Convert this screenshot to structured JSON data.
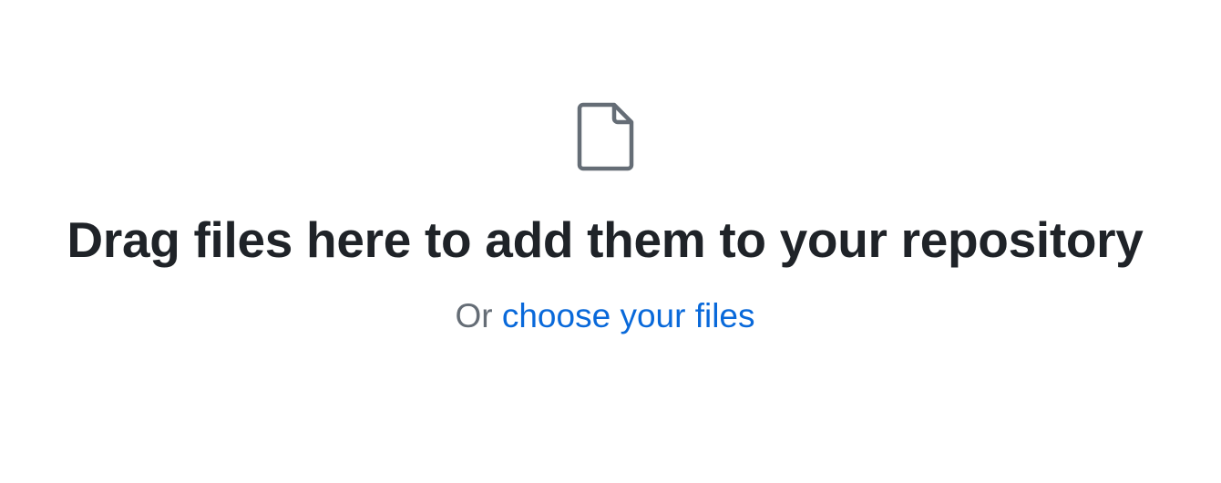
{
  "dropzone": {
    "icon": "file-icon",
    "heading": "Drag files here to add them to your repository",
    "prefix": "Or",
    "link_label": "choose your files"
  },
  "colors": {
    "heading": "#1f2328",
    "muted": "#656d76",
    "link": "#0969da",
    "icon": "#656d76"
  }
}
